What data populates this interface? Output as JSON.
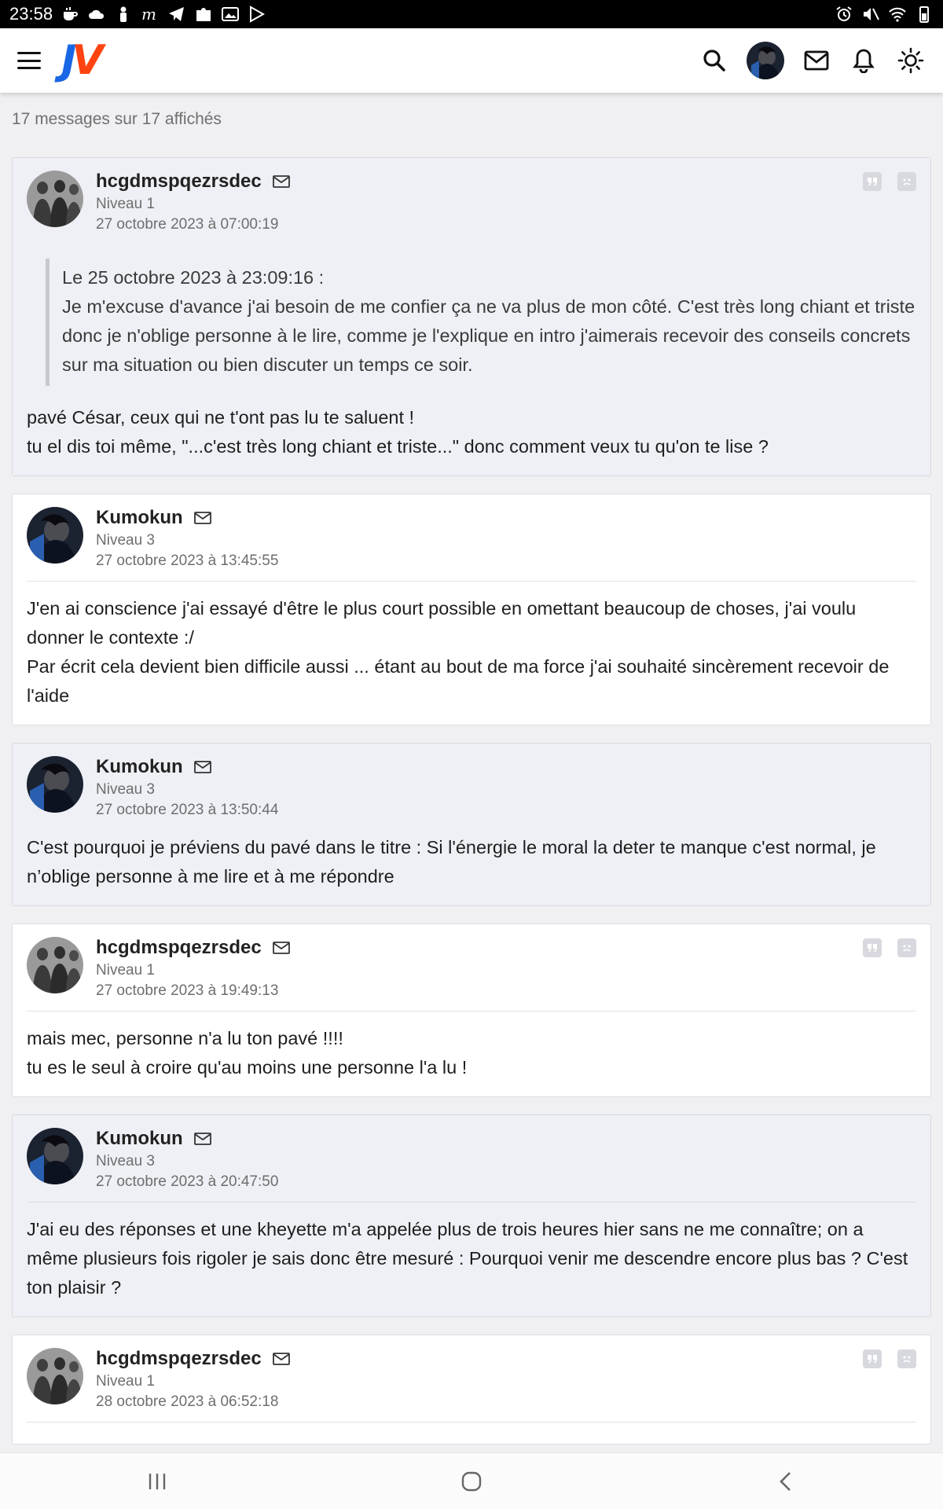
{
  "status_bar": {
    "time": "23:58",
    "left_icons": [
      "cup-icon",
      "cloud-icon",
      "person-icon",
      "m-app-icon",
      "telegram-icon",
      "puzzle-icon",
      "image-icon",
      "play-store-icon"
    ],
    "right_icons": [
      "alarm-icon",
      "mute-icon",
      "wifi-icon",
      "battery-icon"
    ]
  },
  "header": {
    "logo_j": "J",
    "logo_v": "V"
  },
  "main": {
    "message_count": "17 messages sur 17 affichés"
  },
  "posts": [
    {
      "author": "hcgdmspqezrsdec",
      "level": "Niveau 1",
      "date": "27 octobre 2023 à 07:00:19",
      "quote": {
        "header": "Le 25 octobre 2023 à 23:09:16 :",
        "text": "Je m'excuse d'avance j'ai besoin de me confier ça ne va plus de mon côté. C'est très long chiant et triste donc je n'oblige personne à le lire, comme je l'explique en intro j'aimerais recevoir des conseils concrets sur ma situation ou bien discuter un temps ce soir."
      },
      "lines": [
        "pavé César, ceux qui ne t'ont pas lu te saluent !",
        "tu el dis toi même, \"...c'est très long chiant et triste...\" donc comment veux tu qu'on te lise ?"
      ]
    },
    {
      "author": "Kumokun",
      "level": "Niveau 3",
      "date": "27 octobre 2023 à 13:45:55",
      "lines": [
        "J'en ai conscience j'ai essayé d'être le plus court possible en omettant beaucoup de choses, j'ai voulu donner le contexte :/",
        "Par écrit cela devient bien difficile aussi ... étant au bout de ma force j'ai souhaité sincèrement recevoir de l'aide"
      ]
    },
    {
      "author": "Kumokun",
      "level": "Niveau 3",
      "date": "27 octobre 2023 à 13:50:44",
      "lines": [
        "C'est pourquoi je préviens du pavé dans le titre : Si l'énergie le moral la deter te manque c'est normal, je n’oblige personne à me lire et à me répondre"
      ]
    },
    {
      "author": "hcgdmspqezrsdec",
      "level": "Niveau 1",
      "date": "27 octobre 2023 à 19:49:13",
      "lines": [
        "mais mec, personne n'a lu ton pavé !!!!",
        "tu es le seul à croire qu'au moins une personne l'a lu !"
      ]
    },
    {
      "author": "Kumokun",
      "level": "Niveau 3",
      "date": "27 octobre 2023 à 20:47:50",
      "lines": [
        "J'ai eu des réponses et une kheyette m'a appelée plus de trois heures hier sans ne me connaître; on a même plusieurs fois rigoler je sais donc être mesuré : Pourquoi venir me descendre encore plus bas ? C'est ton plaisir ?"
      ]
    },
    {
      "author": "hcgdmspqezrsdec",
      "level": "Niveau 1",
      "date": "28 octobre 2023 à 06:52:18"
    }
  ],
  "colors": {
    "logo_blue": "#1a67e6",
    "logo_orange": "#ff4411",
    "page_bg": "#f0f0f3",
    "alt_post_bg": "#eef0f5"
  }
}
